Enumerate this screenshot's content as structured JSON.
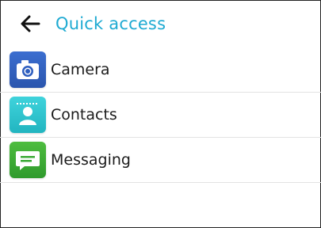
{
  "header": {
    "back_icon": "arrow-left-icon",
    "title": "Quick access",
    "title_color": "#1eaad2"
  },
  "items": [
    {
      "label": "Camera",
      "icon": "camera-icon",
      "color": "#2f5fbf"
    },
    {
      "label": "Contacts",
      "icon": "contact-icon",
      "color": "#2ec5cf"
    },
    {
      "label": "Messaging",
      "icon": "message-icon",
      "color": "#3aaa35"
    }
  ]
}
